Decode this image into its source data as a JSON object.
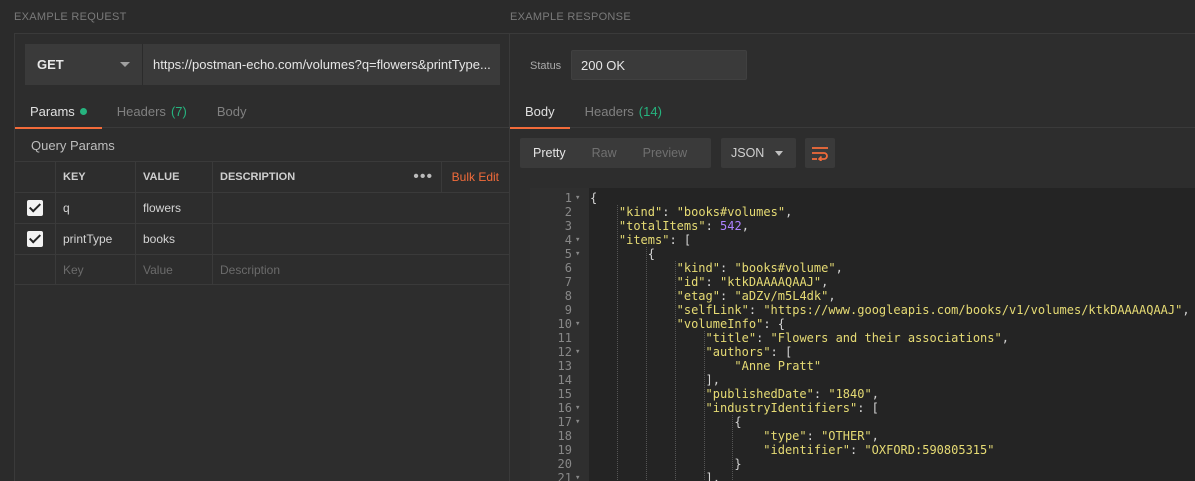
{
  "request": {
    "section_label": "EXAMPLE REQUEST",
    "method": "GET",
    "url": "https://postman-echo.com/volumes?q=flowers&printType...",
    "tabs": [
      {
        "label": "Params",
        "active": true
      },
      {
        "label": "Headers",
        "count": "(7)"
      },
      {
        "label": "Body"
      }
    ],
    "query_params_title": "Query Params",
    "table": {
      "headers": [
        "KEY",
        "VALUE",
        "DESCRIPTION"
      ],
      "bulk_edit": "Bulk Edit",
      "more": "•••",
      "rows": [
        {
          "key": "q",
          "value": "flowers",
          "description": "",
          "checked": true
        },
        {
          "key": "printType",
          "value": "books",
          "description": "",
          "checked": true
        }
      ],
      "placeholder": {
        "key": "Key",
        "value": "Value",
        "description": "Description"
      }
    }
  },
  "response": {
    "section_label": "EXAMPLE RESPONSE",
    "status_label": "Status",
    "status_value": "200 OK",
    "tabs": [
      {
        "label": "Body",
        "active": true
      },
      {
        "label": "Headers",
        "count": "(14)"
      }
    ],
    "view_modes": [
      "Pretty",
      "Raw",
      "Preview"
    ],
    "active_view": "Pretty",
    "format": "JSON",
    "wrap_icon": "wrap-lines-icon",
    "code_lines": [
      {
        "n": "1",
        "fold": true,
        "indent": 0,
        "tokens": [
          [
            "p",
            "{"
          ]
        ]
      },
      {
        "n": "2",
        "indent": 1,
        "tokens": [
          [
            "k",
            "\"kind\""
          ],
          [
            "p",
            ": "
          ],
          [
            "s",
            "\"books#volumes\""
          ],
          [
            "p",
            ","
          ]
        ]
      },
      {
        "n": "3",
        "indent": 1,
        "tokens": [
          [
            "k",
            "\"totalItems\""
          ],
          [
            "p",
            ": "
          ],
          [
            "n",
            "542"
          ],
          [
            "p",
            ","
          ]
        ]
      },
      {
        "n": "4",
        "fold": true,
        "indent": 1,
        "tokens": [
          [
            "k",
            "\"items\""
          ],
          [
            "p",
            ": ["
          ]
        ]
      },
      {
        "n": "5",
        "fold": true,
        "indent": 2,
        "tokens": [
          [
            "p",
            "{"
          ]
        ]
      },
      {
        "n": "6",
        "indent": 3,
        "tokens": [
          [
            "k",
            "\"kind\""
          ],
          [
            "p",
            ": "
          ],
          [
            "s",
            "\"books#volume\""
          ],
          [
            "p",
            ","
          ]
        ]
      },
      {
        "n": "7",
        "indent": 3,
        "tokens": [
          [
            "k",
            "\"id\""
          ],
          [
            "p",
            ": "
          ],
          [
            "s",
            "\"ktkDAAAAQAAJ\""
          ],
          [
            "p",
            ","
          ]
        ]
      },
      {
        "n": "8",
        "indent": 3,
        "tokens": [
          [
            "k",
            "\"etag\""
          ],
          [
            "p",
            ": "
          ],
          [
            "s",
            "\"aDZv/m5L4dk\""
          ],
          [
            "p",
            ","
          ]
        ]
      },
      {
        "n": "9",
        "indent": 3,
        "tokens": [
          [
            "k",
            "\"selfLink\""
          ],
          [
            "p",
            ": "
          ],
          [
            "s",
            "\"https://www.googleapis.com/books/v1/volumes/ktkDAAAAQAAJ\""
          ],
          [
            "p",
            ","
          ]
        ]
      },
      {
        "n": "10",
        "fold": true,
        "indent": 3,
        "tokens": [
          [
            "k",
            "\"volumeInfo\""
          ],
          [
            "p",
            ": {"
          ]
        ]
      },
      {
        "n": "11",
        "indent": 4,
        "tokens": [
          [
            "k",
            "\"title\""
          ],
          [
            "p",
            ": "
          ],
          [
            "s",
            "\"Flowers and their associations\""
          ],
          [
            "p",
            ","
          ]
        ]
      },
      {
        "n": "12",
        "fold": true,
        "indent": 4,
        "tokens": [
          [
            "k",
            "\"authors\""
          ],
          [
            "p",
            ": ["
          ]
        ]
      },
      {
        "n": "13",
        "indent": 5,
        "tokens": [
          [
            "s",
            "\"Anne Pratt\""
          ]
        ]
      },
      {
        "n": "14",
        "indent": 4,
        "tokens": [
          [
            "p",
            "],"
          ]
        ]
      },
      {
        "n": "15",
        "indent": 4,
        "tokens": [
          [
            "k",
            "\"publishedDate\""
          ],
          [
            "p",
            ": "
          ],
          [
            "s",
            "\"1840\""
          ],
          [
            "p",
            ","
          ]
        ]
      },
      {
        "n": "16",
        "fold": true,
        "indent": 4,
        "tokens": [
          [
            "k",
            "\"industryIdentifiers\""
          ],
          [
            "p",
            ": ["
          ]
        ]
      },
      {
        "n": "17",
        "fold": true,
        "indent": 5,
        "tokens": [
          [
            "p",
            "{"
          ]
        ]
      },
      {
        "n": "18",
        "indent": 6,
        "tokens": [
          [
            "k",
            "\"type\""
          ],
          [
            "p",
            ": "
          ],
          [
            "s",
            "\"OTHER\""
          ],
          [
            "p",
            ","
          ]
        ]
      },
      {
        "n": "19",
        "indent": 6,
        "tokens": [
          [
            "k",
            "\"identifier\""
          ],
          [
            "p",
            ": "
          ],
          [
            "s",
            "\"OXFORD:590805315\""
          ]
        ]
      },
      {
        "n": "20",
        "indent": 5,
        "tokens": [
          [
            "p",
            "}"
          ]
        ]
      },
      {
        "n": "21",
        "fold": true,
        "indent": 4,
        "tokens": [
          [
            "p",
            "],"
          ]
        ]
      }
    ]
  },
  "colors": {
    "accent": "#f26b3a",
    "green": "#26b47f",
    "string": "#e6db74",
    "number": "#ae81ff"
  }
}
